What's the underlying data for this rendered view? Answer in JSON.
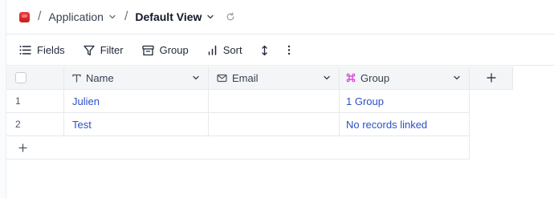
{
  "breadcrumb": {
    "separator": "/",
    "app": "Application",
    "view": "Default View"
  },
  "toolbar": {
    "fields": "Fields",
    "filter": "Filter",
    "group": "Group",
    "sort": "Sort"
  },
  "table": {
    "columns": [
      {
        "label": "Name",
        "icon": "text-type-icon"
      },
      {
        "label": "Email",
        "icon": "mail-icon"
      },
      {
        "label": "Group",
        "icon": "link-command-icon"
      }
    ],
    "rows": [
      {
        "index": "1",
        "name": "Julien",
        "email": "",
        "group": "1 Group"
      },
      {
        "index": "2",
        "name": "Test",
        "email": "",
        "group": "No records linked"
      }
    ],
    "add_symbol": "+"
  },
  "colors": {
    "link": "#2b50c8",
    "header_bg": "#f4f5f7",
    "logo": "#d92626",
    "group_icon": "#d63ad6"
  }
}
